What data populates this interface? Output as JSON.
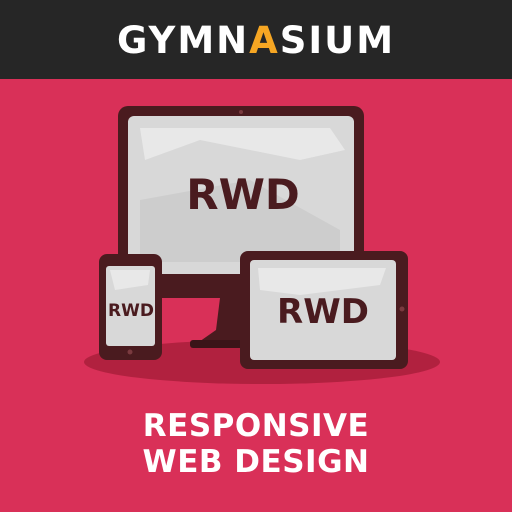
{
  "brand": {
    "prefix": "GYMN",
    "accent_letter": "A",
    "suffix": "SIUM",
    "accent_color": "#f6a623"
  },
  "illustration": {
    "monitor_label": "RWD",
    "tablet_label": "RWD",
    "phone_label": "RWD"
  },
  "course": {
    "title_line1": "RESPONSIVE",
    "title_line2": "WEB DESIGN"
  },
  "colors": {
    "header_bg": "#262626",
    "background": "#d93058",
    "device_frame": "#4a1b1f",
    "screen": "#d8d8d8"
  }
}
